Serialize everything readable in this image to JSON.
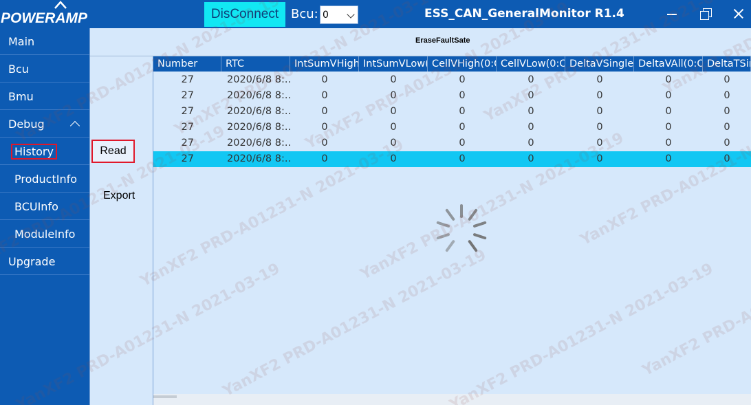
{
  "app": {
    "logo_text": "POWERAMP",
    "title": "ESS_CAN_GeneralMonitor R1.4",
    "disconnect_label": "DisConnect",
    "bcu_label": "Bcu:",
    "bcu_value": "0"
  },
  "sidebar": {
    "items": [
      {
        "label": "Main"
      },
      {
        "label": "Bcu"
      },
      {
        "label": "Bmu"
      },
      {
        "label": "Debug"
      },
      {
        "label": "History"
      },
      {
        "label": "ProductInfo"
      },
      {
        "label": "BCUInfo"
      },
      {
        "label": "ModuleInfo"
      },
      {
        "label": "Upgrade"
      }
    ]
  },
  "header": {
    "erase_label": "EraseFaultSate"
  },
  "actions": {
    "read_label": "Read",
    "export_label": "Export"
  },
  "table": {
    "columns": [
      "Number",
      "RTC",
      "IntSumVHigh",
      "IntSumVLow(",
      "CellVHigh(0:C",
      "CellVLow(0:Ol",
      "DeltaVSingle(",
      "DeltaVAll(0:O",
      "DeltaTSin"
    ],
    "rows": [
      [
        "27",
        "2020/6/8 8:...",
        "0",
        "0",
        "0",
        "0",
        "0",
        "0",
        "0"
      ],
      [
        "27",
        "2020/6/8 8:...",
        "0",
        "0",
        "0",
        "0",
        "0",
        "0",
        "0"
      ],
      [
        "27",
        "2020/6/8 8:...",
        "0",
        "0",
        "0",
        "0",
        "0",
        "0",
        "0"
      ],
      [
        "27",
        "2020/6/8 8:...",
        "0",
        "0",
        "0",
        "0",
        "0",
        "0",
        "0"
      ],
      [
        "27",
        "2020/6/8 8:...",
        "0",
        "0",
        "0",
        "0",
        "0",
        "0",
        "0"
      ],
      [
        "27",
        "2020/6/8 8:...",
        "0",
        "0",
        "0",
        "0",
        "0",
        "0",
        "0"
      ]
    ],
    "selected_row": 5
  },
  "watermark": {
    "text": "YanXF2  PRD-A01231-N  2021-03-19"
  },
  "colors": {
    "primary": "#0d5bb3",
    "accent": "#12e7f3",
    "selection": "#12c7f3",
    "background": "#d6e8fb",
    "highlight_border": "#e0182a"
  }
}
